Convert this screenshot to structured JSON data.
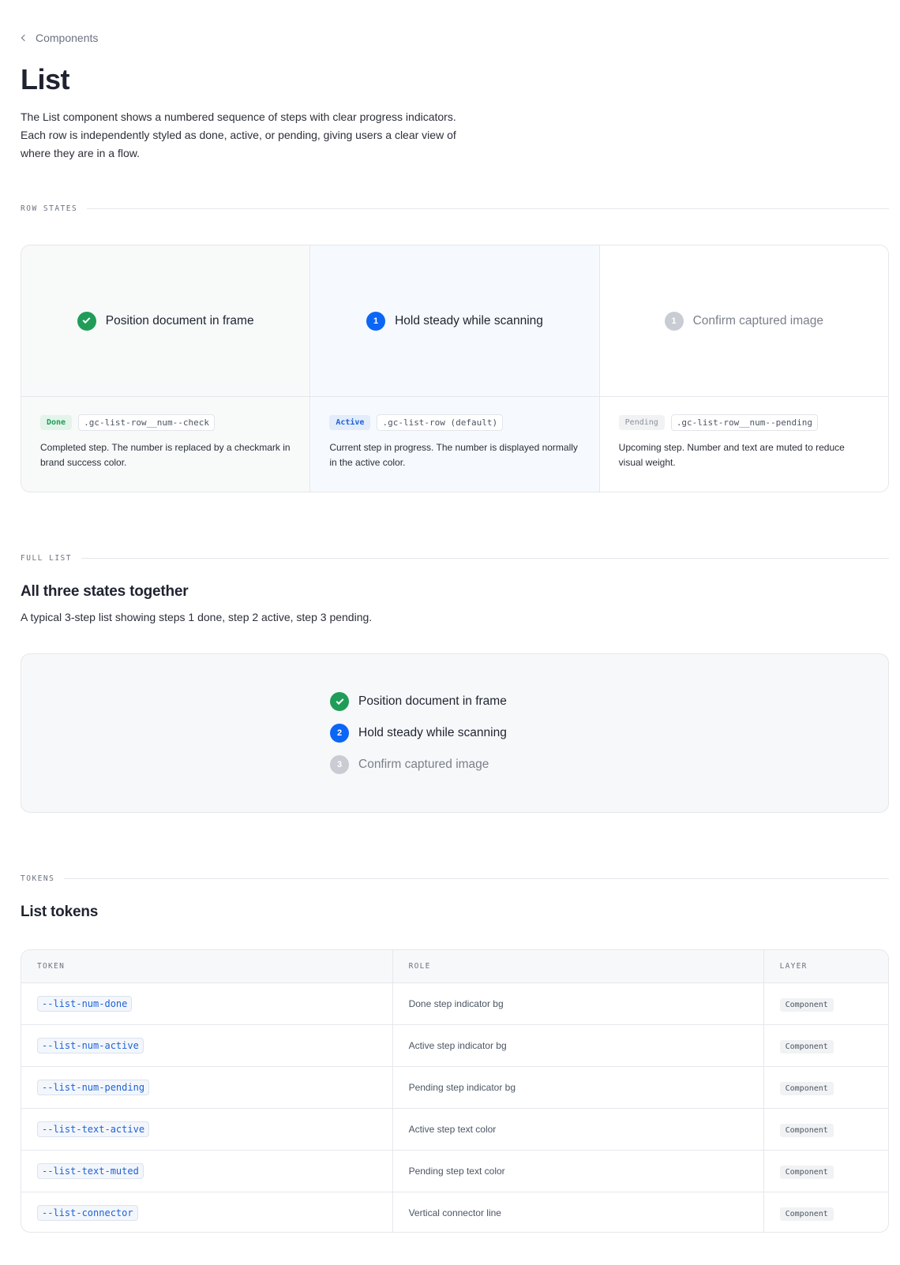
{
  "breadcrumb": {
    "label": "Components"
  },
  "page": {
    "title": "List",
    "intro": "The List component shows a numbered sequence of steps with clear progress indicators. Each row is independently styled as done, active, or pending, giving users a clear view of where they are in a flow."
  },
  "row_states": {
    "section_label": "ROW STATES",
    "states": [
      {
        "state": "done",
        "row_text": "Position document in frame",
        "badge": "Done",
        "class_name": ".gc-list-row__num--check",
        "description": "Completed step. The number is replaced by a checkmark in brand success color."
      },
      {
        "state": "active",
        "number": "1",
        "row_text": "Hold steady while scanning",
        "badge": "Active",
        "class_name": ".gc-list-row (default)",
        "description": "Current step in progress. The number is displayed normally in the active color."
      },
      {
        "state": "pending",
        "number": "1",
        "row_text": "Confirm captured image",
        "badge": "Pending",
        "class_name": ".gc-list-row__num--pending",
        "description": "Upcoming step. Number and text are muted to reduce visual weight."
      }
    ]
  },
  "full_list": {
    "section_label": "FULL LIST",
    "heading": "All three states together",
    "description": "A typical 3-step list showing steps 1 done, step 2 active, step 3 pending.",
    "rows": [
      {
        "state": "done",
        "text": "Position document in frame"
      },
      {
        "state": "active",
        "number": "2",
        "text": "Hold steady while scanning"
      },
      {
        "state": "pending",
        "number": "3",
        "text": "Confirm captured image"
      }
    ]
  },
  "tokens": {
    "section_label": "TOKENS",
    "heading": "List tokens",
    "columns": {
      "token": "TOKEN",
      "role": "ROLE",
      "layer": "LAYER"
    },
    "rows": [
      {
        "token": "--list-num-done",
        "role": "Done step indicator bg",
        "layer": "Component"
      },
      {
        "token": "--list-num-active",
        "role": "Active step indicator bg",
        "layer": "Component"
      },
      {
        "token": "--list-num-pending",
        "role": "Pending step indicator bg",
        "layer": "Component"
      },
      {
        "token": "--list-text-active",
        "role": "Active step text color",
        "layer": "Component"
      },
      {
        "token": "--list-text-muted",
        "role": "Pending step text color",
        "layer": "Component"
      },
      {
        "token": "--list-connector",
        "role": "Vertical connector line",
        "layer": "Component"
      }
    ]
  },
  "colors": {
    "done": "#1f9d58",
    "active": "#0b66f6",
    "pending": "#c9ccd3"
  }
}
